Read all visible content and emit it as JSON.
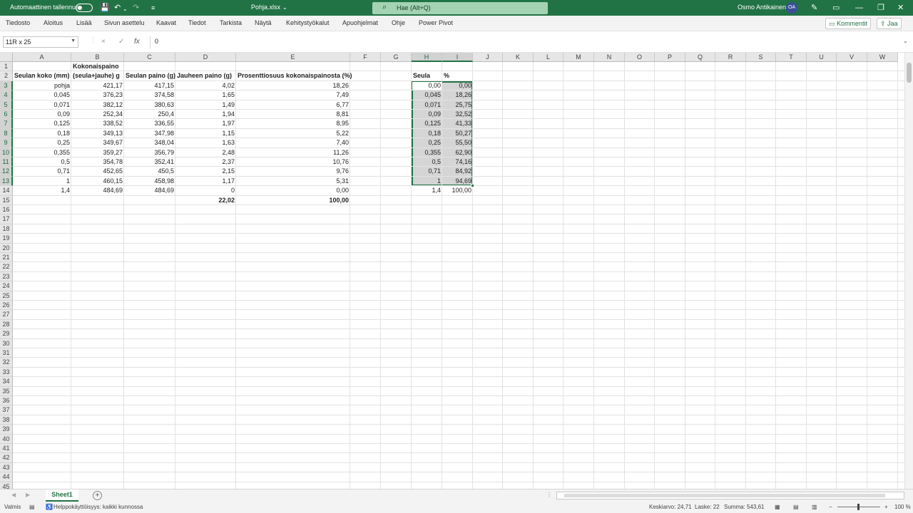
{
  "titlebar": {
    "autosave_label": "Automaattinen tallennus",
    "doc_title": "Pohja.xlsx ⌄",
    "search_placeholder": "Hae (Alt+Q)",
    "user_name": "Osmo Antikainen",
    "avatar_initials": "OA"
  },
  "menu": [
    "Tiedosto",
    "Aloitus",
    "Lisää",
    "Sivun asettelu",
    "Kaavat",
    "Tiedot",
    "Tarkista",
    "Näytä",
    "Kehitystyökalut",
    "Apuohjelmat",
    "Ohje",
    "Power Pivot"
  ],
  "menu_buttons": {
    "comments": "Kommentit",
    "share": "Jaa"
  },
  "formula_bar": {
    "name_box": "11R x 25",
    "cancel_icon": "×",
    "enter_icon": "✓",
    "fx_label": "fx",
    "formula": "0"
  },
  "columns": [
    "A",
    "B",
    "C",
    "D",
    "E",
    "F",
    "G",
    "H",
    "I",
    "J",
    "K",
    "L",
    "M",
    "N",
    "O",
    "P",
    "Q",
    "R",
    "S",
    "T",
    "U",
    "V",
    "W"
  ],
  "rows": [
    "1",
    "2",
    "3",
    "4",
    "5",
    "6",
    "7",
    "8",
    "9",
    "10",
    "11",
    "12",
    "13",
    "14",
    "15",
    "16",
    "17",
    "18",
    "19",
    "20",
    "21",
    "22",
    "23",
    "24",
    "25",
    "26",
    "27",
    "28",
    "29",
    "30",
    "31",
    "32",
    "33",
    "34",
    "35",
    "36",
    "37",
    "38",
    "39",
    "40",
    "41",
    "42",
    "43",
    "44",
    "45"
  ],
  "headers": {
    "B1": "Kokonaispaino",
    "A2": "Seulan koko (mm)",
    "B2": "(seula+jauhe) g",
    "C2": "Seulan paino (g)",
    "D2": "Jauheen paino (g)",
    "E2": "Prosenttiosuus kokonaispainosta (%)",
    "H2": "Seula",
    "I2": "%"
  },
  "table_rows": [
    [
      "pohja",
      "421,17",
      "417,15",
      "4,02",
      "18,26"
    ],
    [
      "0,045",
      "376,23",
      "374,58",
      "1,65",
      "7,49"
    ],
    [
      "0,071",
      "382,12",
      "380,63",
      "1,49",
      "6,77"
    ],
    [
      "0,09",
      "252,34",
      "250,4",
      "1,94",
      "8,81"
    ],
    [
      "0,125",
      "338,52",
      "336,55",
      "1,97",
      "8,95"
    ],
    [
      "0,18",
      "349,13",
      "347,98",
      "1,15",
      "5,22"
    ],
    [
      "0,25",
      "349,67",
      "348,04",
      "1,63",
      "7,40"
    ],
    [
      "0,355",
      "359,27",
      "356,79",
      "2,48",
      "11,26"
    ],
    [
      "0,5",
      "354,78",
      "352,41",
      "2,37",
      "10,76"
    ],
    [
      "0,71",
      "452,65",
      "450,5",
      "2,15",
      "9,76"
    ],
    [
      "1",
      "460,15",
      "458,98",
      "1,17",
      "5,31"
    ],
    [
      "1,4",
      "484,69",
      "484,69",
      "0",
      "0,00"
    ]
  ],
  "totals": {
    "D15": "22,02",
    "E15": "100,00"
  },
  "sieve_rows": [
    [
      "0,00",
      "0,00"
    ],
    [
      "0,045",
      "18,26"
    ],
    [
      "0,071",
      "25,75"
    ],
    [
      "0,09",
      "32,52"
    ],
    [
      "0,125",
      "41,33"
    ],
    [
      "0,18",
      "50,27"
    ],
    [
      "0,25",
      "55,50"
    ],
    [
      "0,355",
      "62,90"
    ],
    [
      "0,5",
      "74,16"
    ],
    [
      "0,71",
      "84,92"
    ],
    [
      "1",
      "94,69"
    ],
    [
      "1,4",
      "100,00"
    ]
  ],
  "sheets": {
    "active": "Sheet1"
  },
  "status": {
    "ready": "Valmis",
    "accessibility": "Helppokäyttöisyys: kaikki kunnossa",
    "average": "Keskiarvo: 24,71",
    "count": "Laske: 22",
    "sum": "Summa: 543,61",
    "zoom": "100 %"
  },
  "colors": {
    "accent": "#217346",
    "selection_fill": "#d5d5d5"
  }
}
